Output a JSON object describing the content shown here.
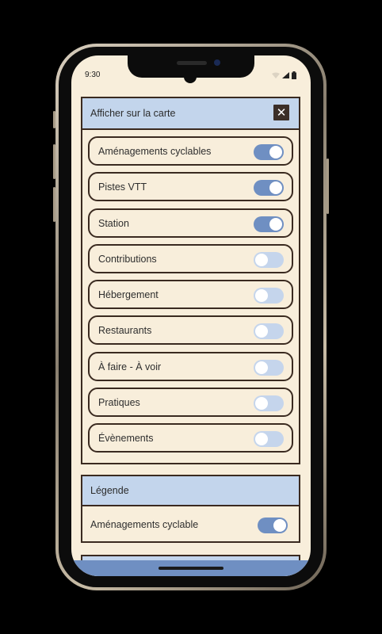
{
  "status_bar": {
    "time": "9:30",
    "icons": [
      "wifi-icon",
      "signal-icon",
      "battery-icon"
    ]
  },
  "map_panel": {
    "title": "Afficher sur la carte",
    "close_icon": "close-icon",
    "items": [
      {
        "label": "Aménagements cyclables",
        "enabled": true
      },
      {
        "label": "Pistes VTT",
        "enabled": true
      },
      {
        "label": "Station",
        "enabled": true
      },
      {
        "label": "Contributions",
        "enabled": false
      },
      {
        "label": "Hébergement",
        "enabled": false
      },
      {
        "label": "Restaurants",
        "enabled": false
      },
      {
        "label": "À faire - À voir",
        "enabled": false
      },
      {
        "label": "Pratiques",
        "enabled": false
      },
      {
        "label": "Évènements",
        "enabled": false
      }
    ]
  },
  "legend": {
    "title": "Légende",
    "items": [
      {
        "label": "Aménagements cyclable",
        "enabled": true
      }
    ]
  },
  "colors": {
    "background": "#f8eedb",
    "header": "#c3d5ec",
    "toggle_on": "#6f8fc2",
    "toggle_off": "#c5d5ec",
    "border": "#3a2a20"
  }
}
